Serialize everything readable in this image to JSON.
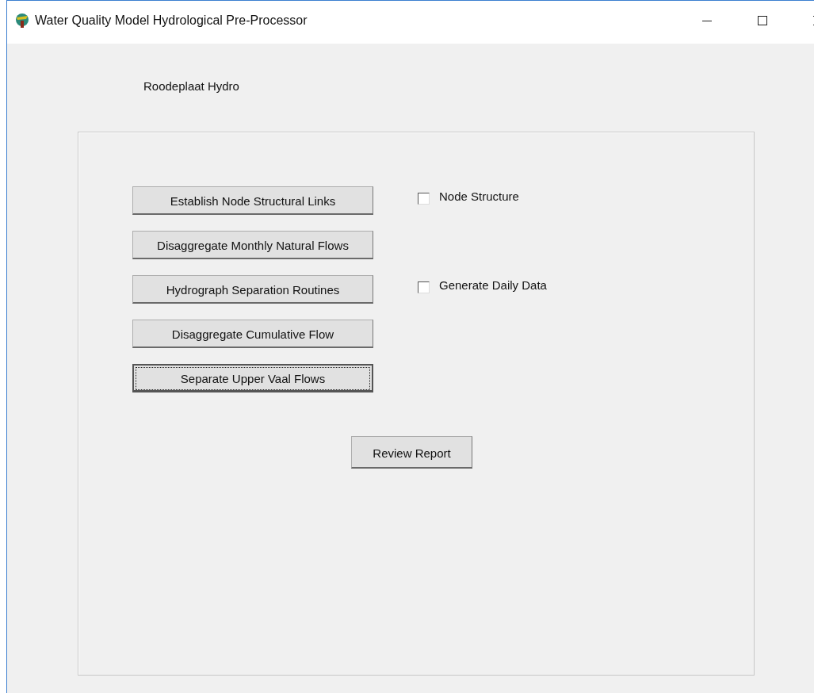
{
  "window": {
    "title": "Water Quality Model Hydrological Pre-Processor"
  },
  "heading": "Roodeplaat Hydro",
  "buttons": [
    {
      "label": "Establish Node Structural Links",
      "focused": false
    },
    {
      "label": "Disaggregate Monthly Natural Flows",
      "focused": false
    },
    {
      "label": "Hydrograph Separation Routines",
      "focused": false
    },
    {
      "label": "Disaggregate Cumulative Flow",
      "focused": false
    },
    {
      "label": "Separate Upper Vaal Flows",
      "focused": true
    }
  ],
  "checkboxes": [
    {
      "label": "Node Structure",
      "checked": false
    },
    {
      "label": "Generate Daily Data",
      "checked": false
    }
  ],
  "report_button": {
    "label": "Review Report"
  }
}
